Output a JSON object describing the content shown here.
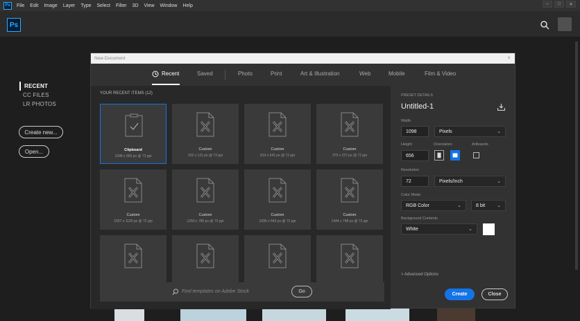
{
  "menubar": {
    "logo": "Ps",
    "items": [
      "File",
      "Edit",
      "Image",
      "Layer",
      "Type",
      "Select",
      "Filter",
      "3D",
      "View",
      "Window",
      "Help"
    ],
    "window_controls": [
      "–",
      "□",
      "✕"
    ]
  },
  "header": {
    "logo": "Ps"
  },
  "leftnav": {
    "items": [
      {
        "label": "RECENT",
        "active": true
      },
      {
        "label": "CC FILES",
        "active": false
      },
      {
        "label": "LR PHOTOS",
        "active": false
      }
    ],
    "create_new": "Create new...",
    "open": "Open..."
  },
  "dialog": {
    "title": "New Document",
    "close": "×",
    "tabs": [
      {
        "label": "Recent",
        "active": true
      },
      {
        "label": "Saved",
        "active": false
      },
      {
        "label": "Photo",
        "active": false
      },
      {
        "label": "Print",
        "active": false
      },
      {
        "label": "Art & Illustration",
        "active": false
      },
      {
        "label": "Web",
        "active": false
      },
      {
        "label": "Mobile",
        "active": false
      },
      {
        "label": "Film & Video",
        "active": false
      }
    ],
    "recent_header": "YOUR RECENT ITEMS  (12)",
    "items": [
      {
        "name": "Clipboard",
        "dims": "1098 x 656 px @ 72 ppi",
        "selected": true,
        "icon": "checkmark-doc-icon"
      },
      {
        "name": "Custom",
        "dims": "232 x 121 px @ 72 ppi",
        "selected": false,
        "icon": "doc-icon"
      },
      {
        "name": "Custom",
        "dims": "814 x 641 px @ 72 ppi",
        "selected": false,
        "icon": "doc-icon"
      },
      {
        "name": "Custom",
        "dims": "375 x 227 px @ 72 ppi",
        "selected": false,
        "icon": "doc-icon"
      },
      {
        "name": "Custom",
        "dims": "1557 x 1135 px @ 72 ppi",
        "selected": false,
        "icon": "doc-icon"
      },
      {
        "name": "Custom",
        "dims": "1259 x 780 px @ 72 ppi",
        "selected": false,
        "icon": "doc-icon"
      },
      {
        "name": "Custom",
        "dims": "1095 x 643 px @ 72 ppi",
        "selected": false,
        "icon": "doc-icon"
      },
      {
        "name": "Custom",
        "dims": "1444 x 748 px @ 72 ppi",
        "selected": false,
        "icon": "doc-icon"
      },
      {
        "name": "",
        "dims": "",
        "selected": false,
        "icon": "doc-icon"
      },
      {
        "name": "",
        "dims": "",
        "selected": false,
        "icon": "doc-icon"
      },
      {
        "name": "",
        "dims": "",
        "selected": false,
        "icon": "doc-icon"
      },
      {
        "name": "",
        "dims": "",
        "selected": false,
        "icon": "doc-icon"
      }
    ],
    "template_search_placeholder": "Find templates on Adobe Stock",
    "go": "Go",
    "preset": {
      "section_label": "PRESET DETAILS",
      "name": "Untitled-1",
      "width_label": "Width",
      "width": "1098",
      "width_unit": "Pixels",
      "height_label": "Height",
      "height": "656",
      "orientation_label": "Orientation",
      "artboards_label": "Artboards",
      "resolution_label": "Resolution",
      "resolution": "72",
      "resolution_unit": "Pixels/Inch",
      "color_mode_label": "Color Mode",
      "color_mode": "RGB Color",
      "bit_depth": "8 bit",
      "background_label": "Background Contents",
      "background": "White",
      "advanced": "> Advanced Options"
    },
    "create": "Create",
    "close_btn": "Close"
  },
  "colors": {
    "accent": "#1473e6",
    "ps_blue": "#31a8ff",
    "ps_dark": "#001e36"
  }
}
